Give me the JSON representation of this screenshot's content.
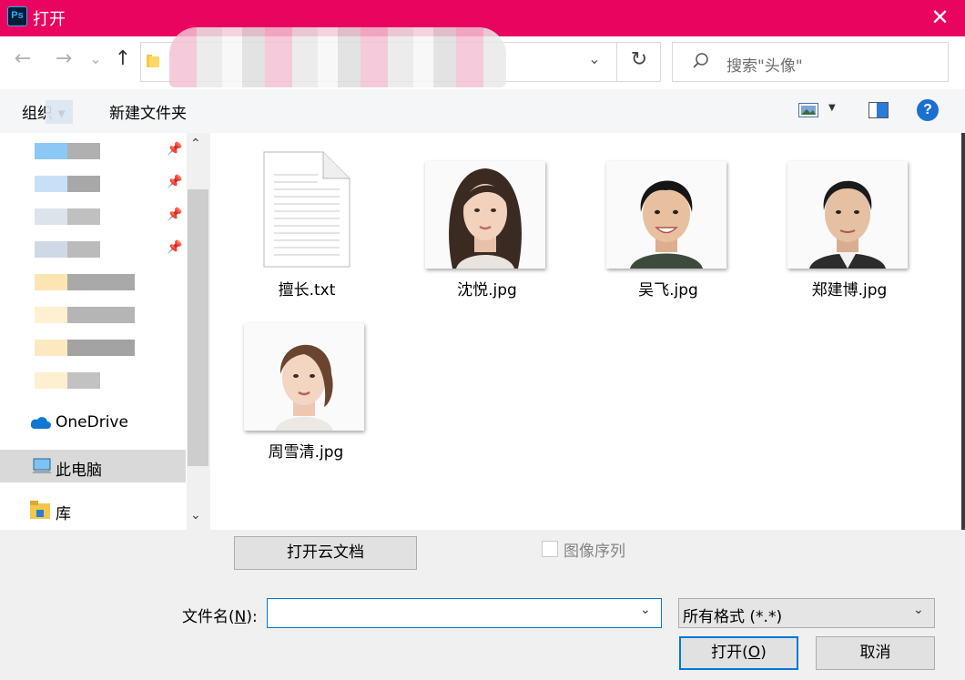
{
  "window": {
    "title": "打开",
    "close_glyph": "✕"
  },
  "nav": {
    "back": "←",
    "forward": "→",
    "recent": "⌄",
    "up": "↑",
    "refresh": "↻",
    "address_chevron": "⌄",
    "address_path": ""
  },
  "search": {
    "placeholder": "搜索\"头像\""
  },
  "toolbar": {
    "organize": "组织 ▾",
    "new_folder": "新建文件夹",
    "view_dropdown": "▼",
    "help": "?"
  },
  "sidebar": {
    "pin": "📌",
    "onedrive": "OneDrive",
    "this_pc": "此电脑",
    "library": "库",
    "scroll_up": "⌃",
    "scroll_down": "⌄"
  },
  "files": [
    {
      "name": "擅长.txt",
      "type": "txt"
    },
    {
      "name": "沈悦.jpg",
      "type": "jpg"
    },
    {
      "name": "吴飞.jpg",
      "type": "jpg"
    },
    {
      "name": "郑建博.jpg",
      "type": "jpg"
    },
    {
      "name": "周雪清.jpg",
      "type": "jpg"
    }
  ],
  "bottom": {
    "cloud_button": "打开云文档",
    "image_sequence": "图像序列",
    "filename_label_prefix": "文件名(",
    "filename_label_key": "N",
    "filename_label_suffix": "):",
    "filename_value": "",
    "filename_chevron": "⌄",
    "filter": "所有格式 (*.*)",
    "filter_chevron": "⌄",
    "open_prefix": "打开(",
    "open_key": "O",
    "open_suffix": ")",
    "cancel": "取消"
  },
  "colors": {
    "titlebar": "#e8045f",
    "accent": "#0078d7"
  }
}
